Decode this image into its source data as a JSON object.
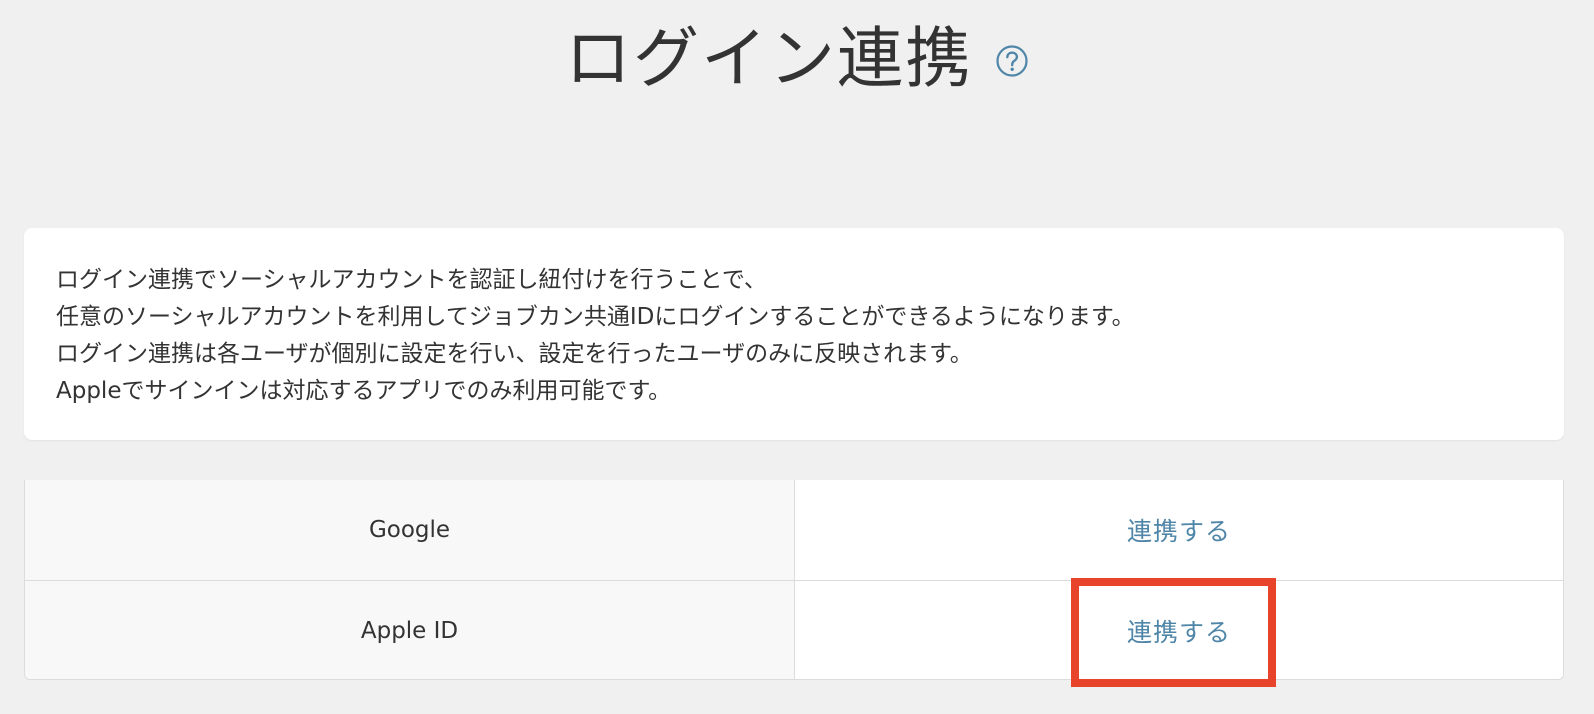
{
  "header": {
    "title": "ログイン連携",
    "help_icon": "question-circle-icon"
  },
  "description": {
    "lines": [
      "ログイン連携でソーシャルアカウントを認証し紐付けを行うことで、",
      "任意のソーシャルアカウントを利用してジョブカン共通IDにログインすることができるようになります。",
      "ログイン連携は各ユーザが個別に設定を行い、設定を行ったユーザのみに反映されます。",
      "Appleでサインインは対応するアプリでのみ利用可能です。"
    ]
  },
  "providers": [
    {
      "name": "Google",
      "action_label": "連携する"
    },
    {
      "name": "Apple ID",
      "action_label": "連携する"
    }
  ],
  "colors": {
    "background": "#f0f0f0",
    "link": "#4f86a8",
    "highlight": "#e8442c",
    "border": "#dcdcdc"
  }
}
